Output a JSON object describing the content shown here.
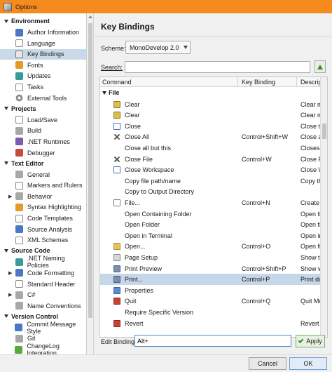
{
  "window": {
    "title": "Options"
  },
  "sidebar": {
    "categories": [
      {
        "label": "Environment",
        "items": [
          {
            "label": "Author Information",
            "icon": "user-icon"
          },
          {
            "label": "Language",
            "icon": "language-icon"
          },
          {
            "label": "Key Bindings",
            "icon": "keyboard-icon",
            "selected": true
          },
          {
            "label": "Fonts",
            "icon": "fonts-icon"
          },
          {
            "label": "Updates",
            "icon": "updates-icon"
          },
          {
            "label": "Tasks",
            "icon": "tasks-icon"
          },
          {
            "label": "External Tools",
            "icon": "tools-icon"
          }
        ]
      },
      {
        "label": "Projects",
        "items": [
          {
            "label": "Load/Save",
            "icon": "load-save-icon"
          },
          {
            "label": "Build",
            "icon": "build-icon"
          },
          {
            "label": ".NET Runtimes",
            "icon": "runtime-icon"
          },
          {
            "label": "Debugger",
            "icon": "debugger-icon"
          }
        ]
      },
      {
        "label": "Text Editor",
        "items": [
          {
            "label": "General",
            "icon": "general-icon"
          },
          {
            "label": "Markers and Rulers",
            "icon": "markers-icon"
          },
          {
            "label": "Behavior",
            "icon": "behavior-icon",
            "expandable": true
          },
          {
            "label": "Syntax Highlighting",
            "icon": "syntax-icon"
          },
          {
            "label": "Code Templates",
            "icon": "templates-icon"
          },
          {
            "label": "Source Analysis",
            "icon": "analysis-icon"
          },
          {
            "label": "XML Schemas",
            "icon": "xml-icon"
          }
        ]
      },
      {
        "label": "Source Code",
        "items": [
          {
            "label": ".NET Naming Policies",
            "icon": "naming-icon"
          },
          {
            "label": "Code Formatting",
            "icon": "formatting-icon",
            "expandable": true
          },
          {
            "label": "Standard Header",
            "icon": "header-icon"
          },
          {
            "label": "C#",
            "icon": "csharp-icon",
            "expandable": true
          },
          {
            "label": "Name Conventions",
            "icon": "conventions-icon"
          }
        ]
      },
      {
        "label": "Version Control",
        "items": [
          {
            "label": "Commit Message Style",
            "icon": "commit-icon"
          },
          {
            "label": "Git",
            "icon": "git-icon"
          },
          {
            "label": "ChangeLog Integration",
            "icon": "changelog-icon"
          }
        ]
      }
    ]
  },
  "main": {
    "heading": "Key Bindings",
    "scheme_label": "Scheme:",
    "scheme_value": "MonoDevelop 2.0",
    "search_label": "Search:",
    "search_value": "",
    "columns": {
      "command": "Command",
      "binding": "Key Binding",
      "description": "Descrip"
    },
    "group": "File",
    "rows": [
      {
        "command": "Clear",
        "binding": "",
        "description": "Clear m",
        "icon": "clear-icon",
        "ic": "clear"
      },
      {
        "command": "Clear",
        "binding": "",
        "description": "Clear m",
        "icon": "clear-icon",
        "ic": "clear"
      },
      {
        "command": "Close",
        "binding": "",
        "description": "Close th",
        "icon": "close-icon",
        "ic": "close"
      },
      {
        "command": "Close All",
        "binding": "Control+Shift+W",
        "description": "Close al",
        "icon": "close-all-icon",
        "ic": "x"
      },
      {
        "command": "Close all but this",
        "binding": "",
        "description": "Closes a",
        "icon": "",
        "ic": ""
      },
      {
        "command": "Close File",
        "binding": "Control+W",
        "description": "Close Fi",
        "icon": "close-file-icon",
        "ic": "x"
      },
      {
        "command": "Close Workspace",
        "binding": "",
        "description": "Close W",
        "icon": "close-workspace-icon",
        "ic": "close"
      },
      {
        "command": "Copy file path/name",
        "binding": "",
        "description": "Copy th",
        "icon": "",
        "ic": ""
      },
      {
        "command": "Copy to Output Directory",
        "binding": "",
        "description": "",
        "icon": "",
        "ic": ""
      },
      {
        "command": "File...",
        "binding": "Control+N",
        "description": "Create a",
        "icon": "new-file-icon",
        "ic": "file"
      },
      {
        "command": "Open Containing Folder",
        "binding": "",
        "description": "Open the",
        "icon": "",
        "ic": ""
      },
      {
        "command": "Open Folder",
        "binding": "",
        "description": "Open the",
        "icon": "",
        "ic": ""
      },
      {
        "command": "Open in Terminal",
        "binding": "",
        "description": "Open in",
        "icon": "",
        "ic": ""
      },
      {
        "command": "Open...",
        "binding": "Control+O",
        "description": "Open file",
        "icon": "open-icon",
        "ic": "open"
      },
      {
        "command": "Page Setup",
        "binding": "",
        "description": "Show th",
        "icon": "page-setup-icon",
        "ic": "page"
      },
      {
        "command": "Print Preview",
        "binding": "Control+Shift+P",
        "description": "Show w",
        "icon": "print-preview-icon",
        "ic": "print"
      },
      {
        "command": "Print...",
        "binding": "Control+P",
        "description": "Print do",
        "icon": "print-icon",
        "ic": "print",
        "selected": true
      },
      {
        "command": "Properties",
        "binding": "",
        "description": "",
        "icon": "properties-icon",
        "ic": "props"
      },
      {
        "command": "Quit",
        "binding": "Control+Q",
        "description": "Quit Mo",
        "icon": "quit-icon",
        "ic": "quit"
      },
      {
        "command": "Require Specific Version",
        "binding": "",
        "description": "",
        "icon": "",
        "ic": ""
      },
      {
        "command": "Revert",
        "binding": "",
        "description": "Revert t",
        "icon": "revert-icon",
        "ic": "revert"
      }
    ],
    "edit_label": "Edit Binding",
    "edit_value": "Alt+",
    "apply_label": "Apply"
  },
  "footer": {
    "cancel_label": "Cancel",
    "ok_label": "OK"
  },
  "colors": {
    "titlebar": "#f58b1f",
    "selection": "#c5d7e8"
  }
}
